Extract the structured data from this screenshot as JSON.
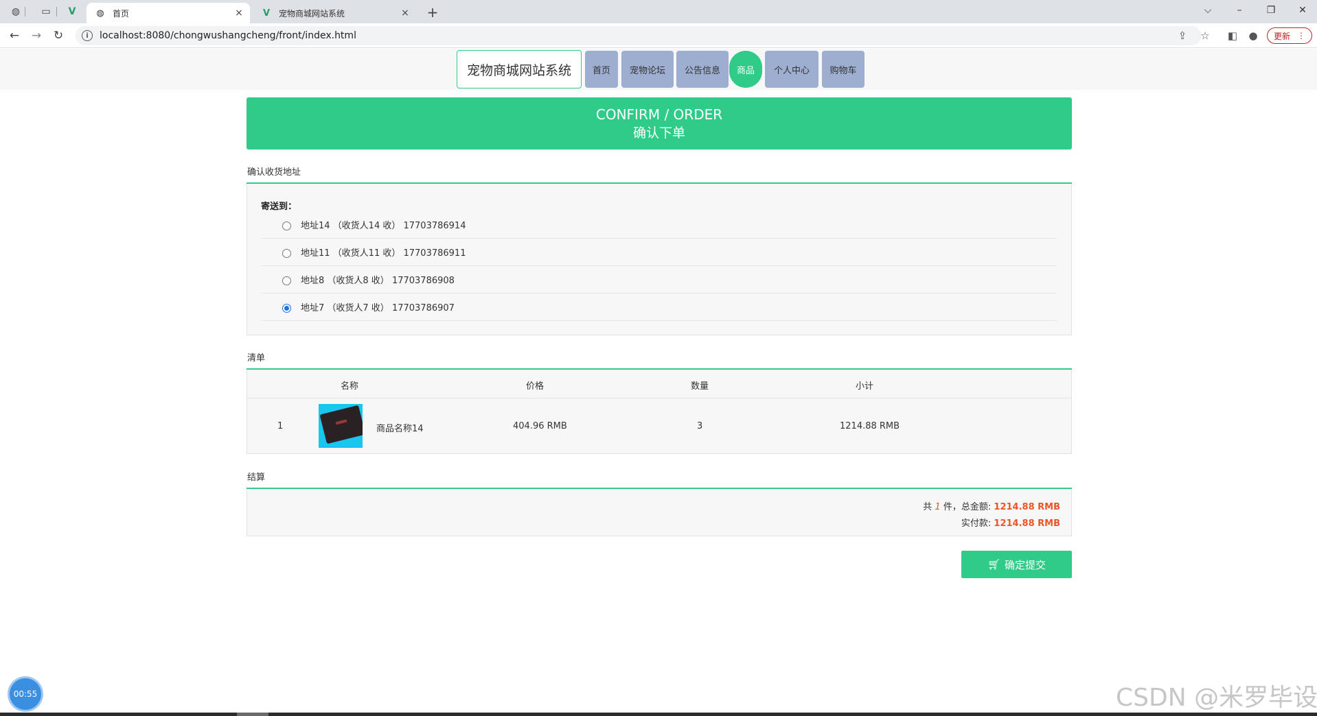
{
  "browser": {
    "tabs": [
      {
        "title": "首页",
        "active": true
      },
      {
        "title": "宠物商城网站系统",
        "active": false
      }
    ],
    "url": "localhost:8080/chongwushangcheng/front/index.html",
    "update_label": "更新",
    "close_glyph": "×",
    "new_tab_glyph": "+"
  },
  "site": {
    "brand": "宠物商城网站系统",
    "nav": [
      {
        "label": "首页",
        "active": false
      },
      {
        "label": "宠物论坛",
        "active": false
      },
      {
        "label": "公告信息",
        "active": false
      },
      {
        "label": "商品",
        "active": true
      },
      {
        "label": "个人中心",
        "active": false
      },
      {
        "label": "购物车",
        "active": false
      }
    ]
  },
  "banner": {
    "en": "CONFIRM / ORDER",
    "cn": "确认下单"
  },
  "address": {
    "section_title": "确认收货地址",
    "ship_to_label": "寄送到：",
    "items": [
      {
        "text": "地址14 （收货人14 收） 17703786914",
        "checked": false
      },
      {
        "text": "地址11 （收货人11 收） 17703786911",
        "checked": false
      },
      {
        "text": "地址8 （收货人8 收） 17703786908",
        "checked": false
      },
      {
        "text": "地址7 （收货人7 收） 17703786907",
        "checked": true
      }
    ]
  },
  "list": {
    "section_title": "清单",
    "headers": {
      "name": "名称",
      "price": "价格",
      "qty": "数量",
      "subtotal": "小计"
    },
    "rows": [
      {
        "index": "1",
        "name": "商品名称14",
        "price": "404.96 RMB",
        "qty": "3",
        "subtotal": "1214.88 RMB"
      }
    ]
  },
  "settlement": {
    "section_title": "结算",
    "count_prefix": "共",
    "count": "1",
    "count_suffix": "件，总金额:",
    "total": "1214.88 RMB",
    "paid_label": "实付款:",
    "paid": "1214.88 RMB"
  },
  "submit_label": "确定提交",
  "timer": "00:55",
  "watermark": "CSDN @米罗毕设",
  "colors": {
    "accent": "#2ecc88",
    "nav": "#9eaed0",
    "amount": "#e8562a"
  }
}
